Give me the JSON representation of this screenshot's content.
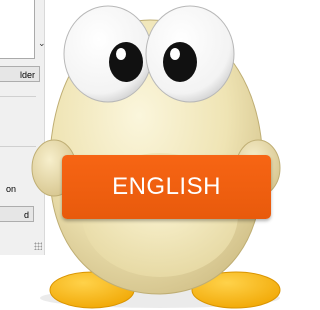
{
  "dialog": {
    "folder_button_label": "lder",
    "status_text": "on",
    "bottom_button_label": "d"
  },
  "mascot": {
    "icon": "egg-mascot-icon"
  },
  "language_badge": {
    "label": "ENGLISH",
    "color": "#f76514"
  }
}
